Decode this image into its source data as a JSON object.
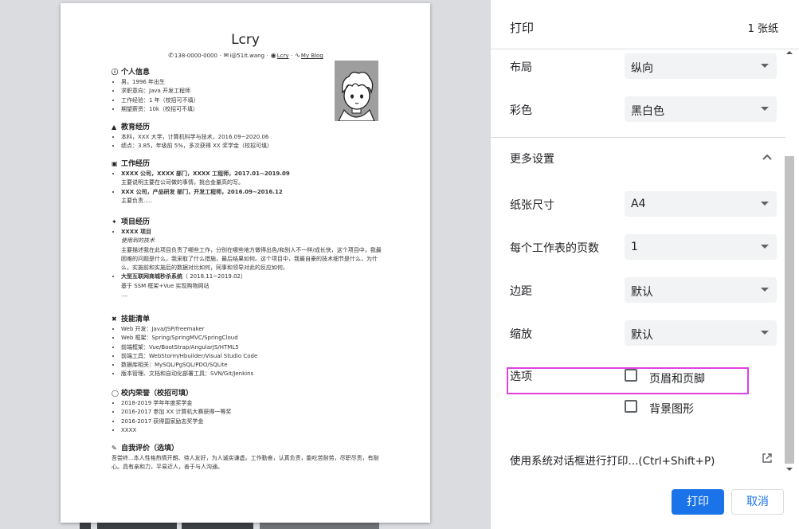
{
  "preview": {
    "resume": {
      "name": "Lcry",
      "contact": {
        "phone": "138-0000-0000",
        "email": "i@51it.wang",
        "github": "Lcry",
        "blog": "My Blog",
        "sep": "·"
      },
      "sections": {
        "personal": {
          "title": "个人信息",
          "items": [
            "男，1996 年出生",
            "求职意向：Java 开发工程师",
            "工作经验：1 年（校招可不填）",
            "期望薪资：10k（校招可不填）"
          ]
        },
        "education": {
          "title": "教育经历",
          "items": [
            "本科，XXX 大学，计算机科学与技术，2016.09~2020.06",
            "绩点：3.85，年级前 5%，多次获得 XX 奖学金（校招可填）"
          ]
        },
        "work": {
          "title": "工作经历",
          "job1_head": "XXXX 公司，XXXX 部门，XXXX 工程师，2017.01~2019.09",
          "job1_desc": "主要说明主要在公司做的事情，挑合金量高的写。",
          "job2_head": "XXX 公司，产品研发 部门，开发工程师，2016.09~2016.12",
          "job2_desc": "主要负责....."
        },
        "projects": {
          "title": "项目经历",
          "p1_name": "XXXX 项目",
          "p1_tech": "使用到的技术",
          "p1_desc": "主要描述我在此项目负责了哪些工作，分别在哪些地方做得出色/和别人不一样/成长快，这个项目中，我最困难的问题是什么，我采取了什么措施，最后结果如何。这个项目中，我最自豪的技术细节是什么，为什么，实施前和实施后的数据对比如何，同事和领导对此的反应如何。",
          "p2_name": "大型互联网商城秒杀系统",
          "p2_date": "（ 2018.11~2019.02）",
          "p2_desc": "基于 SSM 框架+Vue 实现购物网站",
          "p2_more": "...."
        },
        "skills": {
          "title": "技能清单",
          "items": [
            "Web 开发：Java/JSP/freemaker",
            "Web 框架：Spring/SpringMVC/SpringCloud",
            "前端框架：Vue/BootStrap/AngularJS/HTML5",
            "前端工具：WebStorm/Hbuilder/Visual Studio Code",
            "数据库相关：MySQL/PgSQL/PDO/SQLite",
            "版本管理、文档和自动化部署工具：SVN/Git/Jenkins"
          ]
        },
        "honors": {
          "title": "校内荣誉（校招可填）",
          "items": [
            "2018-2019 学年年度奖学金",
            "2016-2017 参加 XX 计算机大赛获得一等奖",
            "2016-2017 获得国家励志奖学金",
            "XXXX"
          ]
        },
        "self": {
          "title": "自我评价（选填）",
          "text": "吾尝终...本人性格热情开朗、待人友好，为人诚实谦虚。工作勤奋，认真负责，能吃苦耐劳，尽职尽责，有耐心。具有亲和力，平易近人，善于与人沟通。"
        }
      }
    }
  },
  "panel": {
    "title": "打印",
    "sheet_count": "1 张纸",
    "layout": {
      "label": "布局",
      "value": "纵向"
    },
    "color": {
      "label": "彩色",
      "value": "黑白色"
    },
    "more_settings": "更多设置",
    "paper_size": {
      "label": "纸张尺寸",
      "value": "A4"
    },
    "pages_per_sheet": {
      "label": "每个工作表的页数",
      "value": "1"
    },
    "margins": {
      "label": "边距",
      "value": "默认"
    },
    "scale": {
      "label": "缩放",
      "value": "默认"
    },
    "options": {
      "label": "选项",
      "headers_footers": "页眉和页脚",
      "background_graphics": "背景图形",
      "headers_footers_checked": false,
      "background_graphics_checked": false
    },
    "system_dialog": "使用系统对话框进行打印...(Ctrl+Shift+P)",
    "print_button": "打印",
    "cancel_button": "取消"
  },
  "colors": {
    "accent": "#1a73e8",
    "highlight": "#e040e0",
    "select_bg": "#f1f3f4"
  }
}
